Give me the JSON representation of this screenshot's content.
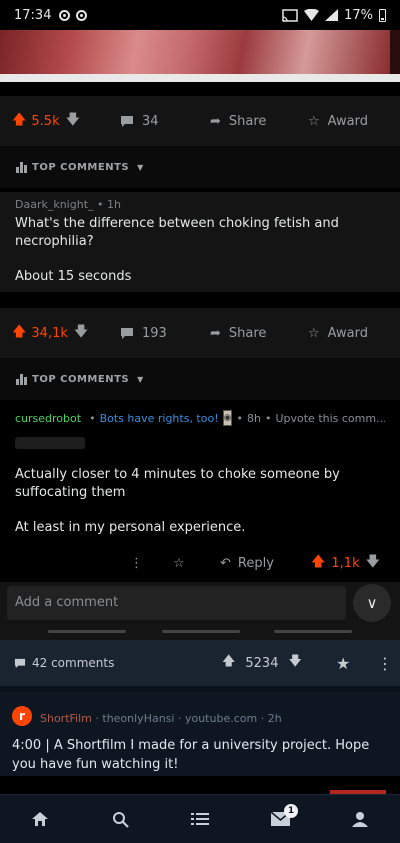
{
  "status_bar": {
    "time": "17:34",
    "battery": "17%"
  },
  "post1": {
    "upvotes": "5.5k",
    "comments": "34",
    "share_label": "Share",
    "award_label": "Award",
    "section_header": "TOP COMMENTS",
    "top_comment": {
      "author": "Daark_knight_",
      "age": "1h",
      "body": [
        "What's the difference between choking fetish and necrophilia?",
        "About 15 seconds"
      ]
    }
  },
  "post2": {
    "upvotes": "34,1k",
    "comments": "193",
    "share_label": "Share",
    "award_label": "Award",
    "section_header": "TOP COMMENTS",
    "top_comment": {
      "author": "cursedrobot",
      "flair": "Bots have rights, too!",
      "age": "8h",
      "extra": "Upvote this comm...",
      "body": [
        "Actually closer to 4 minutes to choke someone by suffocating them",
        "At least in my personal experience."
      ],
      "reply_label": "Reply",
      "votes": "1,1k"
    }
  },
  "add_comment": {
    "placeholder": "Add a comment"
  },
  "feed": {
    "comments": "42 comments",
    "score": "5234",
    "subreddit": "ShortFilm",
    "user": "theonlyHansi",
    "domain": "youtube.com",
    "age": "2h",
    "title": "4:00 | A Shortfilm I made for a university project. Hope you have fun watching it!"
  },
  "bottom_nav": {
    "inbox_badge": "1"
  },
  "colors": {
    "upvote": "#ff4500",
    "bot_green": "#46d160",
    "flair_blue": "#3a8dde"
  }
}
